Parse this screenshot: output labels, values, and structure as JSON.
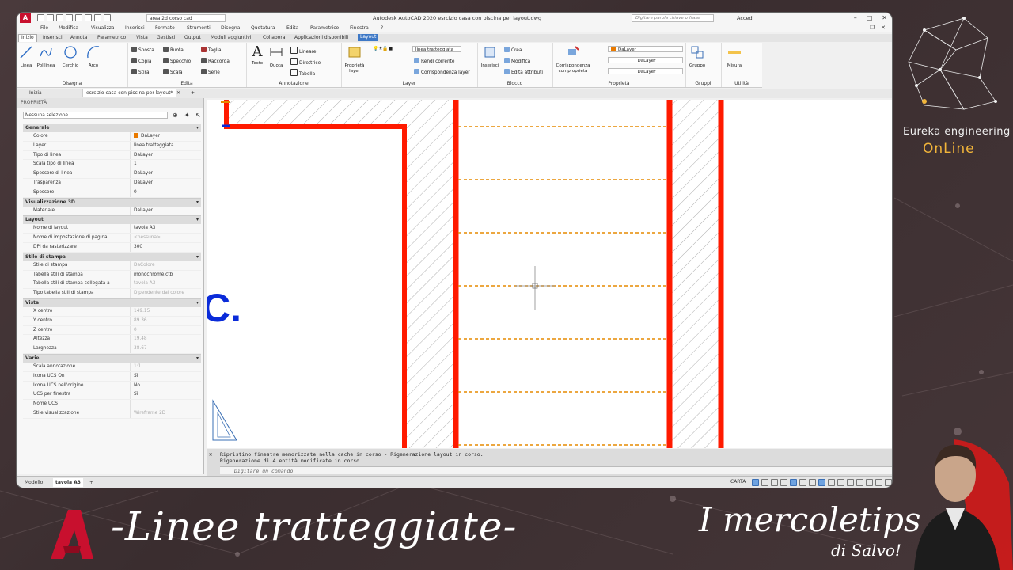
{
  "app": {
    "title": "Autodesk AutoCAD 2020  esrcizio casa con piscina per layout.dwg",
    "workspace": "area 2d corso cad",
    "search_placeholder": "Digitare parola chiave o frase",
    "sign_in": "Accedi"
  },
  "menubar": [
    "File",
    "Modifica",
    "Visualizza",
    "Inserisci",
    "Formato",
    "Strumenti",
    "Disegna",
    "Quotatura",
    "Edita",
    "Parametrico",
    "Finestra",
    "?"
  ],
  "ribbon_tabs": [
    "Inizio",
    "Inserisci",
    "Annota",
    "Parametrico",
    "Vista",
    "Gestisci",
    "Output",
    "Moduli aggiuntivi",
    "Collabora",
    "Applicazioni disponibili",
    "Layout"
  ],
  "ribbon": {
    "disegna": {
      "title": "Disegna",
      "linea": "Linea",
      "polilinea": "Polilinea",
      "cerchio": "Cerchio",
      "arco": "Arco"
    },
    "edita": {
      "title": "Edita",
      "sposta": "Sposta",
      "ruota": "Ruota",
      "taglia": "Taglia",
      "copia": "Copia",
      "specchio": "Specchio",
      "raccorda": "Raccorda",
      "stira": "Stira",
      "scala": "Scala",
      "serie": "Serie"
    },
    "annotazione": {
      "title": "Annotazione",
      "testo": "Testo",
      "quota": "Quota",
      "lineare": "Lineare",
      "direttrice": "Direttrice",
      "tabella": "Tabella"
    },
    "layer": {
      "title": "Layer",
      "proprieta_layer": "Proprietà layer",
      "current_layer": "linea tratteggiata",
      "rendi_corrente": "Rendi corrente",
      "corrispondenza": "Corrispondenza layer"
    },
    "blocco": {
      "title": "Blocco",
      "inserisci": "Inserisci",
      "crea": "Crea",
      "modifica": "Modifica",
      "edita_attributi": "Edita attributi"
    },
    "proprieta": {
      "title": "Proprietà",
      "corrispondenza": "Corrispondenza con proprietà",
      "color": "DaLayer",
      "linetype": "DaLayer",
      "lineweight": "DaLayer"
    },
    "gruppi": {
      "title": "Gruppi",
      "gruppo": "Gruppo"
    },
    "utilita": {
      "title": "Utilità",
      "misura": "Misura"
    }
  },
  "doc_tabs": [
    "Inizia",
    "esrcizio casa con piscina per layout*"
  ],
  "properties": {
    "header": "PROPRIETÀ",
    "selection": "Nessuna selezione",
    "sections": [
      {
        "name": "Generale",
        "rows": [
          {
            "k": "Colore",
            "v": "DaLayer",
            "swatch": true
          },
          {
            "k": "Layer",
            "v": "linea tratteggiata"
          },
          {
            "k": "Tipo di linea",
            "v": "DaLayer"
          },
          {
            "k": "Scala tipo di linea",
            "v": "1"
          },
          {
            "k": "Spessore di linea",
            "v": "DaLayer"
          },
          {
            "k": "Trasparenza",
            "v": "DaLayer"
          },
          {
            "k": "Spessore",
            "v": "0"
          }
        ]
      },
      {
        "name": "Visualizzazione 3D",
        "rows": [
          {
            "k": "Materiale",
            "v": "DaLayer"
          }
        ]
      },
      {
        "name": "Layout",
        "rows": [
          {
            "k": "Nome di layout",
            "v": "tavola A3"
          },
          {
            "k": "Nome di impostazione di pagina",
            "v": "<nessuna>",
            "dim": true
          },
          {
            "k": "DPI da rasterizzare",
            "v": "300"
          }
        ]
      },
      {
        "name": "Stile di stampa",
        "rows": [
          {
            "k": "Stile di stampa",
            "v": "DaColore",
            "dim": true
          },
          {
            "k": "Tabella stili di stampa",
            "v": "monochrome.ctb"
          },
          {
            "k": "Tabella stili di stampa collegata a",
            "v": "tavola A3",
            "dim": true
          },
          {
            "k": "Tipo tabella stili di stampa",
            "v": "Dipendente dal colore",
            "dim": true
          }
        ]
      },
      {
        "name": "Vista",
        "rows": [
          {
            "k": "X centro",
            "v": "149.15",
            "dim": true
          },
          {
            "k": "Y centro",
            "v": "89.36",
            "dim": true
          },
          {
            "k": "Z centro",
            "v": "0",
            "dim": true
          },
          {
            "k": "Altezza",
            "v": "19.48",
            "dim": true
          },
          {
            "k": "Larghezza",
            "v": "38.67",
            "dim": true
          }
        ]
      },
      {
        "name": "Varie",
        "rows": [
          {
            "k": "Scala annotazione",
            "v": "1:1",
            "dim": true
          },
          {
            "k": "Icona UCS On",
            "v": "Sì"
          },
          {
            "k": "Icona UCS nell'origine",
            "v": "No"
          },
          {
            "k": "UCS per finestra",
            "v": "Sì"
          },
          {
            "k": "Nome UCS",
            "v": ""
          },
          {
            "k": "Stile visualizzazione",
            "v": "Wireframe 2D",
            "dim": true
          }
        ]
      }
    ]
  },
  "drawing": {
    "text_fragment": "C."
  },
  "command": {
    "line1": "Ripristino finestre memorizzate nella cache in corso - Rigenerazione layout in corso.",
    "line2": "Rigenerazione di 4 entità modificate in corso.",
    "placeholder": "Digitare un comando"
  },
  "status": {
    "tab_model": "Modello",
    "tab_layout": "tavola A3",
    "space": "CARTA"
  },
  "branding": {
    "company": "Eureka engineering",
    "online": "OnLine",
    "title": "-Linee tratteggiate-",
    "series": "I mercoletips",
    "author": "di Salvo!"
  }
}
